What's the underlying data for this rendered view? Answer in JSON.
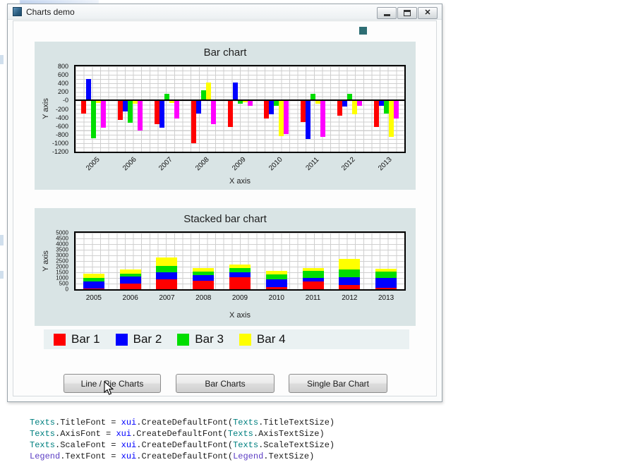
{
  "window": {
    "title": "Charts demo",
    "close_glyph": "✕"
  },
  "chart_data": [
    {
      "type": "bar",
      "title": "Bar chart",
      "xlabel": "X axis",
      "ylabel": "Y axis",
      "categories": [
        "2005",
        "2006",
        "2007",
        "2008",
        "2009",
        "2010",
        "2011",
        "2012",
        "2013"
      ],
      "ylim": [
        -1200,
        800
      ],
      "y_ticks": [
        "800",
        "600",
        "400",
        "200",
        "-0",
        "-200",
        "-400",
        "-600",
        "-800",
        "-1000",
        "-1200"
      ],
      "grid": true,
      "x_tick_rotation": -45,
      "series": [
        {
          "color": "#ff0000",
          "values": [
            -300,
            -460,
            -560,
            -1000,
            -620,
            -420,
            -500,
            -360,
            -620
          ]
        },
        {
          "color": "#0000ff",
          "values": [
            500,
            -260,
            -640,
            -300,
            420,
            -320,
            -900,
            -140,
            -120
          ]
        },
        {
          "color": "#00dd00",
          "values": [
            -880,
            -520,
            150,
            230,
            -80,
            -120,
            150,
            160,
            -300
          ]
        },
        {
          "color": "#ffff00",
          "values": [
            -60,
            -80,
            -60,
            420,
            -40,
            -830,
            -80,
            -320,
            -860
          ]
        },
        {
          "color": "#ff00ff",
          "values": [
            -640,
            -700,
            -420,
            -560,
            -120,
            -780,
            -860,
            -120,
            -420
          ]
        }
      ]
    },
    {
      "type": "stacked-bar",
      "title": "Stacked bar chart",
      "xlabel": "X axis",
      "ylabel": "Y axis",
      "categories": [
        "2005",
        "2006",
        "2007",
        "2008",
        "2009",
        "2010",
        "2011",
        "2012",
        "2013"
      ],
      "ylim": [
        0,
        5000
      ],
      "y_ticks": [
        "5000",
        "4500",
        "4000",
        "3500",
        "3000",
        "2500",
        "2000",
        "1500",
        "1000",
        "500",
        "0"
      ],
      "grid": true,
      "x_tick_rotation": 0,
      "series": [
        {
          "name": "Bar 1",
          "color": "#ff0000",
          "values": [
            80,
            480,
            880,
            780,
            1050,
            180,
            680,
            380,
            150
          ]
        },
        {
          "name": "Bar 2",
          "color": "#0000ff",
          "values": [
            620,
            620,
            620,
            480,
            420,
            720,
            300,
            680,
            880
          ]
        },
        {
          "name": "Bar 3",
          "color": "#00dd00",
          "values": [
            280,
            300,
            580,
            320,
            380,
            420,
            620,
            720,
            520
          ]
        },
        {
          "name": "Bar 4",
          "color": "#ffff00",
          "values": [
            380,
            380,
            720,
            300,
            350,
            280,
            280,
            880,
            250
          ]
        }
      ]
    }
  ],
  "legend": {
    "items": [
      {
        "label": "Bar 1",
        "color": "#ff0000"
      },
      {
        "label": "Bar 2",
        "color": "#0000ff"
      },
      {
        "label": "Bar 3",
        "color": "#00dd00"
      },
      {
        "label": "Bar 4",
        "color": "#ffff00"
      }
    ]
  },
  "buttons": [
    {
      "label": "Line / Pie Charts"
    },
    {
      "label": "Bar Charts"
    },
    {
      "label": "Single Bar Chart"
    }
  ],
  "code": {
    "colors": {
      "texts": "#008080",
      "xui": "#0000ff",
      "legend": "#5b3cc4",
      "plain": "#1a1a1a"
    },
    "lines": [
      [
        {
          "t": "Texts",
          "c": "texts"
        },
        {
          "t": ".TitleFont = ",
          "c": "plain"
        },
        {
          "t": "xui",
          "c": "xui"
        },
        {
          "t": ".CreateDefaultFont(",
          "c": "plain"
        },
        {
          "t": "Texts",
          "c": "texts"
        },
        {
          "t": ".TitleTextSize)",
          "c": "plain"
        }
      ],
      [
        {
          "t": "Texts",
          "c": "texts"
        },
        {
          "t": ".AxisFont = ",
          "c": "plain"
        },
        {
          "t": "xui",
          "c": "xui"
        },
        {
          "t": ".CreateDefaultFont(",
          "c": "plain"
        },
        {
          "t": "Texts",
          "c": "texts"
        },
        {
          "t": ".AxisTextSize)",
          "c": "plain"
        }
      ],
      [
        {
          "t": "Texts",
          "c": "texts"
        },
        {
          "t": ".ScaleFont = ",
          "c": "plain"
        },
        {
          "t": "xui",
          "c": "xui"
        },
        {
          "t": ".CreateDefaultFont(",
          "c": "plain"
        },
        {
          "t": "Texts",
          "c": "texts"
        },
        {
          "t": ".ScaleTextSize)",
          "c": "plain"
        }
      ],
      [
        {
          "t": "Legend",
          "c": "legend"
        },
        {
          "t": ".TextFont = ",
          "c": "plain"
        },
        {
          "t": "xui",
          "c": "xui"
        },
        {
          "t": ".CreateDefaultFont(",
          "c": "plain"
        },
        {
          "t": "Legend",
          "c": "legend"
        },
        {
          "t": ".TextSize)",
          "c": "plain"
        }
      ]
    ]
  }
}
